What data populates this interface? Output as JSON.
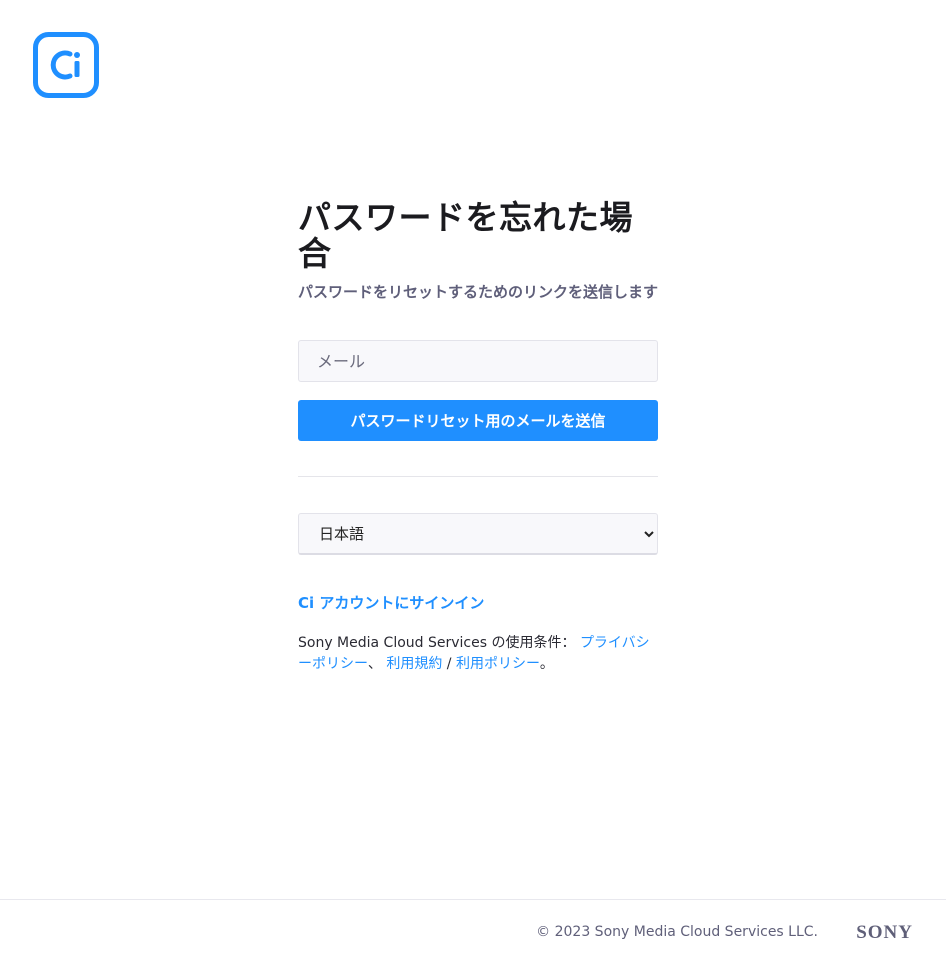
{
  "brand": {
    "logo_icon": "ci-logo-icon",
    "accent_color": "#1f8fff"
  },
  "form": {
    "title": "パスワードを忘れた場合",
    "subtitle": "パスワードをリセットするためのリンクを送信します",
    "email_placeholder": "メール",
    "email_value": "",
    "submit_label": "パスワードリセット用のメールを送信"
  },
  "language": {
    "selected": "日本語"
  },
  "links": {
    "signin": "Ci アカウントにサインイン",
    "terms_prefix": "Sony Media Cloud Services の使用条件：",
    "privacy_policy": "プライバシーポリシー",
    "separator1": "、",
    "terms_of_use": "利用規約",
    "separator2": " / ",
    "usage_policy": "利用ポリシー",
    "period": "。"
  },
  "footer": {
    "copyright": "© 2023 Sony Media Cloud Services LLC.",
    "sony_logo": "SONY"
  }
}
